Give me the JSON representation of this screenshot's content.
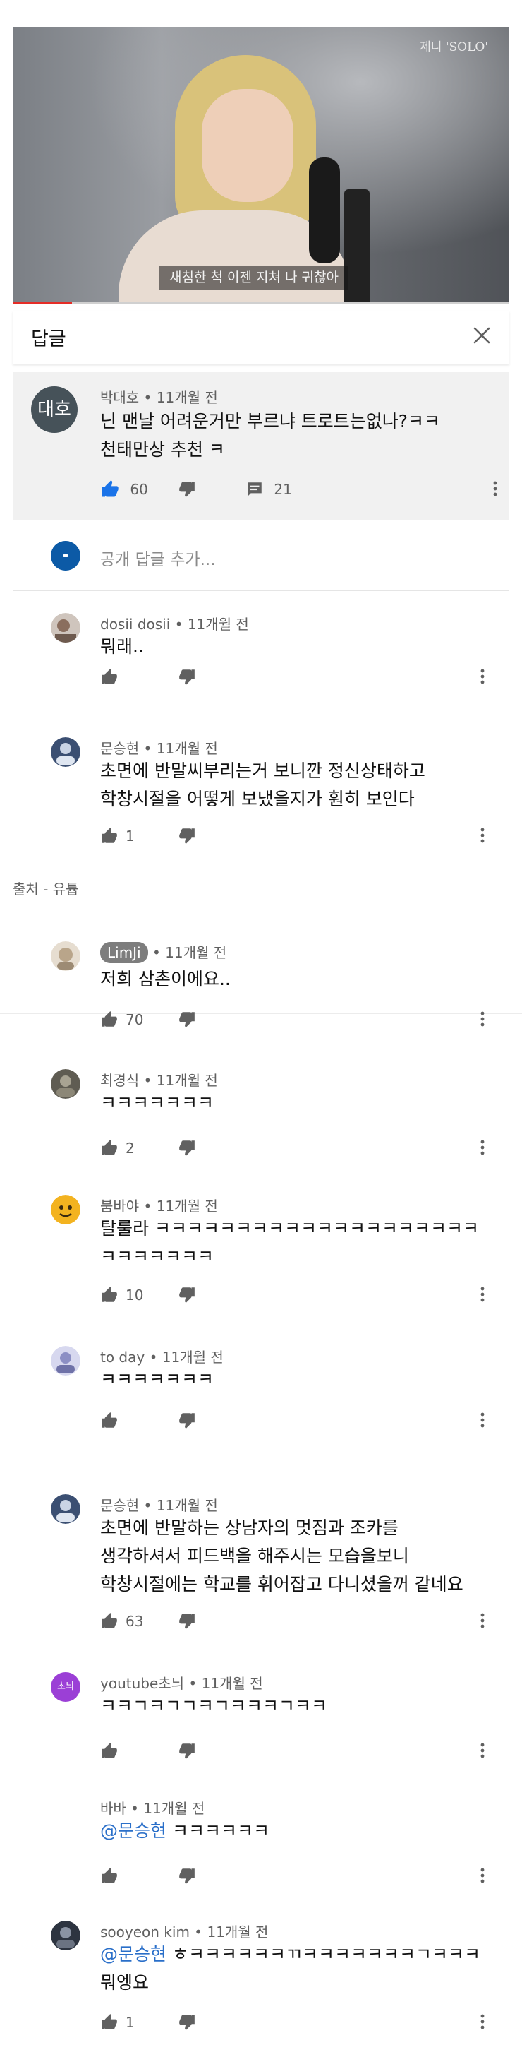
{
  "video": {
    "channel_tag": "제니 'SOLO'",
    "subtitle": "새침한 척 이젠 지쳐 나 귀찮아",
    "progress_fraction": 0.12
  },
  "panel": {
    "title": "답글"
  },
  "parent_comment": {
    "avatar_text": "대호",
    "author": "박대호",
    "time": "11개월 전",
    "lines": [
      "닌 맨날 어려운거만 부르냐 트로트는없나?ㅋㅋ",
      "천태만상 추천 ㅋ"
    ],
    "likes": "60",
    "replies": "21"
  },
  "add_reply": {
    "placeholder": "공개 답글 추가..."
  },
  "source_label": "출처 - 유튭",
  "comments": [
    {
      "author": "dosii dosii",
      "time": "11개월 전",
      "lines": [
        "뭐래.."
      ],
      "likes": "",
      "avatar_color": "#8a6e5e"
    },
    {
      "author": "문승현",
      "time": "11개월 전",
      "lines": [
        "초면에 반말씨부리는거 보니깐 정신상태하고",
        "학창시절을 어떻게 보냈을지가 훤히 보인다"
      ],
      "likes": "1",
      "avatar_color": "#3b4f72"
    },
    {
      "author": "LimJi",
      "time": "11개월 전",
      "lines": [
        "저희 삼촌이에요.."
      ],
      "likes": "70",
      "avatar_color": "#b9a58a"
    },
    {
      "author": "최경식",
      "time": "11개월 전",
      "lines": [
        "ㅋㅋㅋㅋㅋㅋㅋ"
      ],
      "likes": "2",
      "avatar_color": "#6d6a5e"
    },
    {
      "author": "붐바야",
      "time": "11개월 전",
      "lines": [
        "탈룰라 ㅋㅋㅋㅋㅋㅋㅋㅋㅋㅋㅋㅋㅋㅋㅋㅋㅋㅋㅋㅋ",
        "ㅋㅋㅋㅋㅋㅋㅋ"
      ],
      "likes": "10",
      "avatar_color": "#e8a21a"
    },
    {
      "author": "to day",
      "time": "11개월 전",
      "lines": [
        "ㅋㅋㅋㅋㅋㅋㅋ"
      ],
      "likes": "",
      "avatar_color": "#8c8fc4"
    },
    {
      "author": "문승현",
      "time": "11개월 전",
      "lines": [
        "초면에 반말하는 상남자의 멋짐과 조카를",
        "생각하셔서 피드백을 해주시는 모습을보니",
        "학창시절에는 학교를 휘어잡고 다니셨을꺼 같네요"
      ],
      "likes": "63",
      "avatar_color": "#3b4f72"
    },
    {
      "author": "youtube초늬",
      "time": "11개월 전",
      "lines": [
        "ㅋㅋㄱㅋㄱㄱㅋㄱㅋㅋㅋㄱㅋㅋ"
      ],
      "likes": "",
      "avatar_color": "#9b3fd6",
      "avatar_text": "초늬"
    },
    {
      "author": "바바",
      "time": "11개월 전",
      "mention": "@문승현",
      "lines": [
        "ㅋㅋㅋㅋㅋㅋ"
      ],
      "likes": ""
    },
    {
      "author": "sooyeon kim",
      "time": "11개월 전",
      "mention": "@문승현",
      "lines": [
        "ㅎㅋㅋㅋㅋㅋㅋㄲㅋㅋㅋㅋㅋㅋㅋㄱㅋㅋㅋ",
        "뭐엥요"
      ],
      "likes": "1",
      "avatar_color": "#2d3440"
    }
  ],
  "colors": {
    "like_blue": "#1a73e8",
    "mention_blue": "#2a6fc9",
    "icon_grey": "#606060"
  }
}
